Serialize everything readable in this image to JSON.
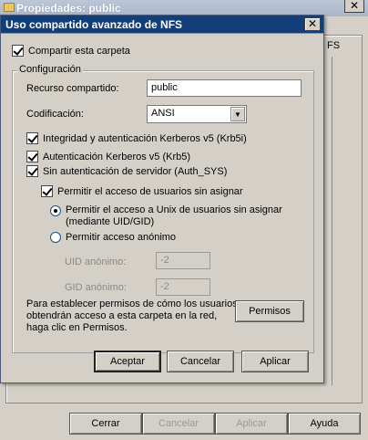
{
  "back_window": {
    "title": "Propiedades: public",
    "close_glyph": "✕",
    "tab_label": "FS",
    "buttons": {
      "cerrar": "Cerrar",
      "cancelar": "Cancelar",
      "aplicar": "Aplicar",
      "ayuda": "Ayuda"
    }
  },
  "dialog": {
    "title": "Uso compartido avanzado de NFS",
    "close_glyph": "✕",
    "share_checkbox": {
      "label": "Compartir esta carpeta",
      "checked": true
    },
    "config_group": {
      "legend": "Configuración",
      "resource_label": "Recurso compartido:",
      "resource_value": "public",
      "encoding_label": "Codificación:",
      "encoding_value": "ANSI",
      "encoding_arrow": "▼",
      "krb5i": {
        "label": "Integridad y autenticación Kerberos v5 (Krb5i)",
        "checked": true
      },
      "krb5": {
        "label": "Autenticación Kerberos v5 (Krb5)",
        "checked": true
      },
      "auth_sys": {
        "label": "Sin autenticación de servidor (Auth_SYS)",
        "checked": true
      },
      "unmapped": {
        "label": "Permitir el acceso de usuarios sin asignar",
        "checked": true
      },
      "radio_unix": {
        "line1": "Permitir el acceso a Unix de usuarios sin asignar",
        "line2": "(mediante UID/GID)",
        "selected": true
      },
      "radio_anon": {
        "label": "Permitir acceso anónimo",
        "selected": false
      },
      "uid_label": "UID anónimo:",
      "uid_value": "-2",
      "gid_label": "GID anónimo:",
      "gid_value": "-2",
      "permissions_text": {
        "line1": "Para establecer permisos de cómo los usuarios",
        "line2": "obtendrán acceso a esta carpeta en la red,",
        "line3": "haga clic en Permisos."
      },
      "permissions_button": "Permisos"
    },
    "buttons": {
      "aceptar": "Aceptar",
      "cancelar": "Cancelar",
      "aplicar": "Aplicar"
    }
  }
}
